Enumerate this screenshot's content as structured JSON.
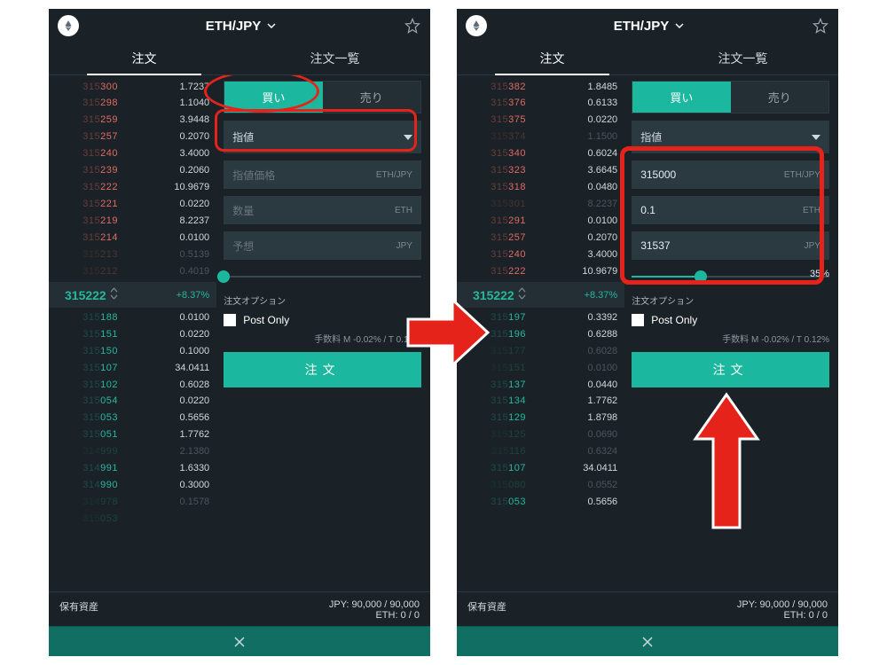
{
  "colors": {
    "accent": "#1bb89f",
    "ask": "#e16a63",
    "bid": "#25b89f",
    "annotation": "#e5231b"
  },
  "common": {
    "pair": "ETH/JPY",
    "tab_order": "注文",
    "tab_orderlist": "注文一覧",
    "buy_label": "買い",
    "sell_label": "売り",
    "ordertype": "指値",
    "options_label": "注文オプション",
    "postonly_label": "Post Only",
    "fee_text": "手数料 M -0.02% / T 0.12%",
    "submit_label": "注文",
    "balance_label": "保有資産",
    "balance_jpy": "JPY: 90,000 / 90,000",
    "balance_eth": "ETH: 0 / 0",
    "mid_price": "315222",
    "mid_change": "+8.37%"
  },
  "left": {
    "price_field": {
      "placeholder": "指値価格",
      "unit": "ETH/JPY",
      "value": ""
    },
    "qty_field": {
      "placeholder": "数量",
      "unit": "ETH",
      "value": ""
    },
    "est_field": {
      "placeholder": "予想",
      "unit": "JPY",
      "value": ""
    },
    "slider_pct": 0,
    "asks": [
      {
        "price": "315300",
        "qty": "1.7237",
        "split": 3
      },
      {
        "price": "315298",
        "qty": "1.1040",
        "split": 3
      },
      {
        "price": "315259",
        "qty": "3.9448",
        "split": 3
      },
      {
        "price": "315257",
        "qty": "0.2070",
        "split": 3
      },
      {
        "price": "315240",
        "qty": "3.4000",
        "split": 3
      },
      {
        "price": "315239",
        "qty": "0.2060",
        "split": 3
      },
      {
        "price": "315222",
        "qty": "10.9679",
        "split": 3
      },
      {
        "price": "315221",
        "qty": "0.0220",
        "split": 3
      },
      {
        "price": "315219",
        "qty": "8.2237",
        "split": 3
      },
      {
        "price": "315214",
        "qty": "0.0100",
        "split": 3
      },
      {
        "price": "315213",
        "qty": "0.5139",
        "split": 3,
        "dim": true
      },
      {
        "price": "315212",
        "qty": "0.4019",
        "split": 3,
        "dim": true
      }
    ],
    "bids": [
      {
        "price": "315188",
        "qty": "0.0100",
        "split": 3
      },
      {
        "price": "315151",
        "qty": "0.0220",
        "split": 3
      },
      {
        "price": "315150",
        "qty": "0.1000",
        "split": 3
      },
      {
        "price": "315107",
        "qty": "34.0411",
        "split": 3
      },
      {
        "price": "315102",
        "qty": "0.6028",
        "split": 3
      },
      {
        "price": "315054",
        "qty": "0.0220",
        "split": 3
      },
      {
        "price": "315053",
        "qty": "0.5656",
        "split": 3
      },
      {
        "price": "315051",
        "qty": "1.7762",
        "split": 3
      },
      {
        "price": "314999",
        "qty": "2.1380",
        "split": 3,
        "dim": true
      },
      {
        "price": "314991",
        "qty": "1.6330",
        "split": 3
      },
      {
        "price": "314990",
        "qty": "0.3000",
        "split": 3
      },
      {
        "price": "314978",
        "qty": "0.1578",
        "split": 3,
        "dim": true
      },
      {
        "price": "315053",
        "qty": "",
        "split": 3,
        "dim": true
      }
    ]
  },
  "right": {
    "price_field": {
      "placeholder": "",
      "unit": "ETH/JPY",
      "value": "315000"
    },
    "qty_field": {
      "placeholder": "",
      "unit": "ETH",
      "value": "0.1"
    },
    "est_field": {
      "placeholder": "",
      "unit": "JPY",
      "value": "31537"
    },
    "slider_pct": 35,
    "asks": [
      {
        "price": "315382",
        "qty": "1.8485",
        "split": 3
      },
      {
        "price": "315376",
        "qty": "0.6133",
        "split": 3
      },
      {
        "price": "315375",
        "qty": "0.0220",
        "split": 3
      },
      {
        "price": "315374",
        "qty": "1.1500",
        "split": 3,
        "dim": true
      },
      {
        "price": "315340",
        "qty": "0.6024",
        "split": 3
      },
      {
        "price": "315323",
        "qty": "3.6645",
        "split": 3
      },
      {
        "price": "315318",
        "qty": "0.0480",
        "split": 3
      },
      {
        "price": "315301",
        "qty": "8.2237",
        "split": 3,
        "dim": true
      },
      {
        "price": "315291",
        "qty": "0.0100",
        "split": 3
      },
      {
        "price": "315257",
        "qty": "0.2070",
        "split": 3
      },
      {
        "price": "315240",
        "qty": "3.4000",
        "split": 3
      },
      {
        "price": "315222",
        "qty": "10.9679",
        "split": 3
      }
    ],
    "bids": [
      {
        "price": "315197",
        "qty": "0.3392",
        "split": 3
      },
      {
        "price": "315196",
        "qty": "0.6288",
        "split": 3
      },
      {
        "price": "315177",
        "qty": "0.6028",
        "split": 3,
        "dim": true
      },
      {
        "price": "315151",
        "qty": "0.0100",
        "split": 3,
        "dim": true
      },
      {
        "price": "315137",
        "qty": "0.0440",
        "split": 3
      },
      {
        "price": "315134",
        "qty": "1.7762",
        "split": 3
      },
      {
        "price": "315129",
        "qty": "1.8798",
        "split": 3
      },
      {
        "price": "315125",
        "qty": "0.0690",
        "split": 3,
        "dim": true
      },
      {
        "price": "315116",
        "qty": "0.6324",
        "split": 3,
        "dim": true
      },
      {
        "price": "315107",
        "qty": "34.0411",
        "split": 3
      },
      {
        "price": "315080",
        "qty": "0.0552",
        "split": 3,
        "dim": true
      },
      {
        "price": "315053",
        "qty": "0.5656",
        "split": 3
      }
    ]
  }
}
